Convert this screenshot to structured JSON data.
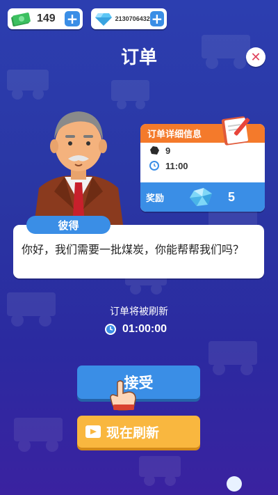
{
  "currency": {
    "cash_value": "149",
    "gems_value": "2130706432"
  },
  "title": "订单",
  "details": {
    "header": "订单详细信息",
    "coal_qty": "9",
    "time": "11:00",
    "reward_label": "奖励",
    "reward_value": "5"
  },
  "npc": {
    "name": "彼得",
    "dialogue": "你好，我们需要一批煤炭，你能帮帮我们吗？"
  },
  "refresh": {
    "label": "订单将被刷新",
    "timer": "01:00:00"
  },
  "buttons": {
    "accept": "接受",
    "refresh_now": "现在刷新"
  },
  "colors": {
    "background": "#2b36a8",
    "accent_blue": "#3a8ee6",
    "accent_orange": "#f47a2b",
    "accent_yellow": "#f9b73f",
    "close_red": "#e0425c"
  }
}
